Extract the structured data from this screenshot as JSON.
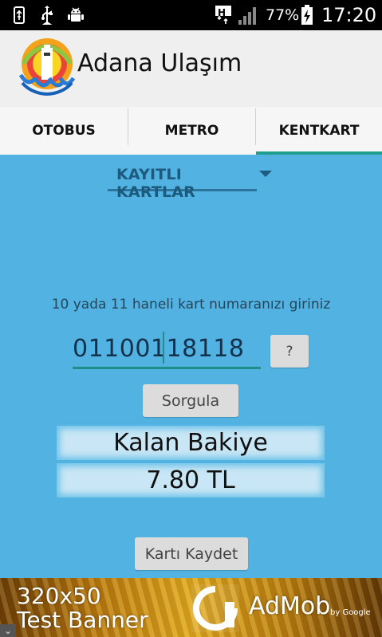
{
  "status_bar": {
    "network_type": "H",
    "battery_percent": "77%",
    "time": "17:20",
    "icons": [
      "usb-icon",
      "usb-debug-icon",
      "android-debug-icon",
      "signal-icon",
      "battery-charging-icon"
    ]
  },
  "app_bar": {
    "title": "Adana Ulaşım"
  },
  "tabs": [
    {
      "label": "OTOBUS",
      "selected": false
    },
    {
      "label": "METRO",
      "selected": false
    },
    {
      "label": "KENTKART",
      "selected": true
    }
  ],
  "colors": {
    "accent": "#1f9e8e",
    "background": "#52b2e2",
    "result_box": "#c8e6f5"
  },
  "main": {
    "spinner_label": "KAYITLI KARTLAR",
    "hint": "10 yada 11 haneli kart numaranızı giriniz",
    "card_number": "01100118118",
    "help_button": "?",
    "query_button": "Sorgula",
    "balance_label": "Kalan Bakiye",
    "balance_value": "7.80 TL",
    "save_button": "Kartı Kaydet"
  },
  "ad_banner": {
    "text_line1": "320x50",
    "text_line2": "Test Banner",
    "brand": "AdMob",
    "brand_sub": "by Google"
  }
}
